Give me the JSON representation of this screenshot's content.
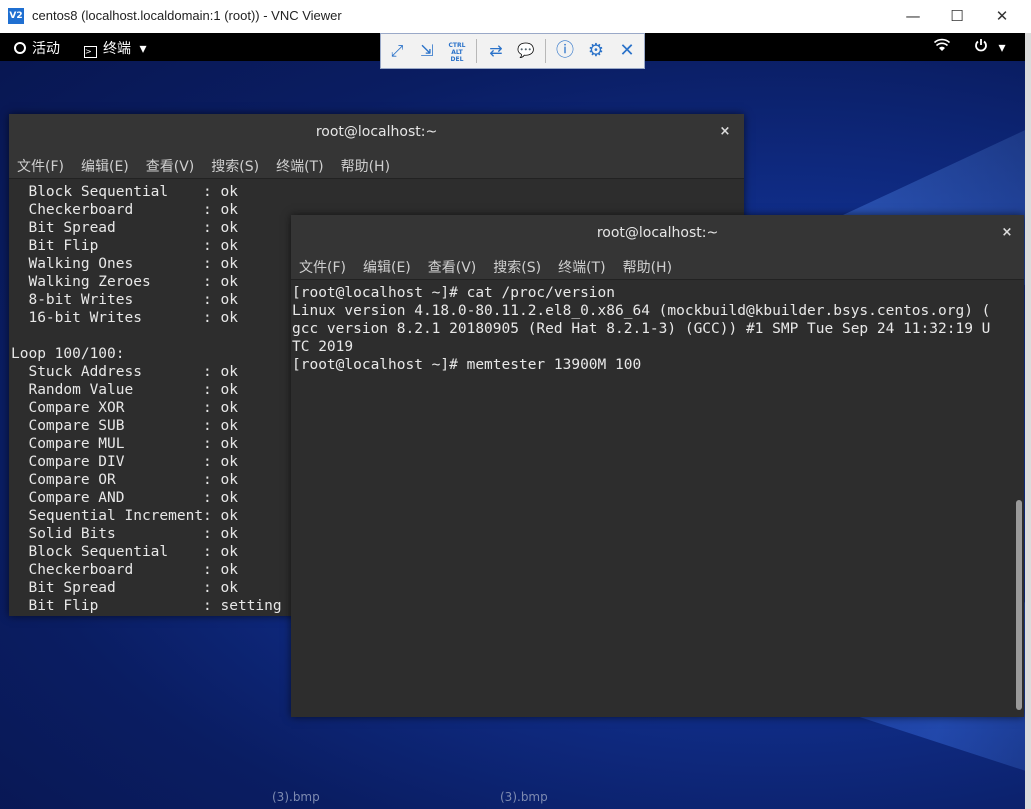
{
  "vnc": {
    "logo": "V2",
    "title": "centos8 (localhost.localdomain:1 (root)) - VNC Viewer",
    "minimize": "—",
    "maximize": "☐",
    "close": "✕"
  },
  "gnome": {
    "activities": "活动",
    "app_menu": "终端",
    "app_menu_arrow": "▾",
    "wifi": "wifi-icon",
    "power": "power-icon",
    "power_arrow": "▾"
  },
  "toolbar": {
    "buttons": [
      {
        "icon": "fullscreen-icon",
        "glyph": "⤢"
      },
      {
        "icon": "scale-icon",
        "glyph": "⇲"
      },
      {
        "icon": "ctrl-alt-del-icon",
        "glyph": "CTRL ALT DEL"
      },
      {
        "icon": "transfer-icon",
        "glyph": "⇄"
      },
      {
        "icon": "chat-icon",
        "glyph": "💬"
      },
      {
        "icon": "info-icon",
        "glyph": "ⓘ"
      },
      {
        "icon": "settings-icon",
        "glyph": "⚙"
      },
      {
        "icon": "close-icon",
        "glyph": "✕"
      }
    ]
  },
  "term1": {
    "title": "root@localhost:~",
    "close": "×",
    "menu": [
      "文件(F)",
      "编辑(E)",
      "查看(V)",
      "搜索(S)",
      "终端(T)",
      "帮助(H)"
    ],
    "lines": [
      "  Block Sequential    : ok",
      "  Checkerboard        : ok",
      "  Bit Spread          : ok",
      "  Bit Flip            : ok",
      "  Walking Ones        : ok",
      "  Walking Zeroes      : ok",
      "  8-bit Writes        : ok",
      "  16-bit Writes       : ok",
      "",
      "Loop 100/100:",
      "  Stuck Address       : ok",
      "  Random Value        : ok",
      "  Compare XOR         : ok",
      "  Compare SUB         : ok",
      "  Compare MUL         : ok",
      "  Compare DIV         : ok",
      "  Compare OR          : ok",
      "  Compare AND         : ok",
      "  Sequential Increment: ok",
      "  Solid Bits          : ok",
      "  Block Sequential    : ok",
      "  Checkerboard        : ok",
      "  Bit Spread          : ok",
      "  Bit Flip            : setting"
    ]
  },
  "term2": {
    "title": "root@localhost:~",
    "close": "×",
    "menu": [
      "文件(F)",
      "编辑(E)",
      "查看(V)",
      "搜索(S)",
      "终端(T)",
      "帮助(H)"
    ],
    "lines": [
      "[root@localhost ~]# cat /proc/version",
      "Linux version 4.18.0-80.11.2.el8_0.x86_64 (mockbuild@kbuilder.bsys.centos.org) (",
      "gcc version 8.2.1 20180905 (Red Hat 8.2.1-3) (GCC)) #1 SMP Tue Sep 24 11:32:19 U",
      "TC 2019",
      "[root@localhost ~]# memtester 13900M 100"
    ]
  },
  "desktop_labels": [
    "(3).bmp",
    "(3).bmp"
  ]
}
